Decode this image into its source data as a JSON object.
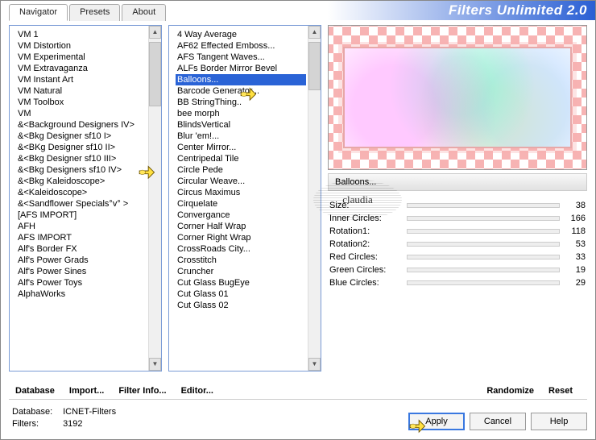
{
  "header": {
    "title": "Filters Unlimited 2.0"
  },
  "tabs": [
    {
      "label": "Navigator",
      "active": true
    },
    {
      "label": "Presets",
      "active": false
    },
    {
      "label": "About",
      "active": false
    }
  ],
  "categories": [
    "VM 1",
    "VM Distortion",
    "VM Experimental",
    "VM Extravaganza",
    "VM Instant Art",
    "VM Natural",
    "VM Toolbox",
    "VM",
    "&<Background Designers IV>",
    "&<Bkg Designer sf10 I>",
    "&<BKg Designer sf10 II>",
    "&<Bkg Designer sf10 III>",
    "&<Bkg Designers sf10 IV>",
    "&<Bkg Kaleidoscope>",
    "&<Kaleidoscope>",
    "&<Sandflower Specials°v° >",
    "[AFS IMPORT]",
    "AFH",
    "AFS IMPORT",
    "Alf's Border FX",
    "Alf's Power Grads",
    "Alf's Power Sines",
    "Alf's Power Toys",
    "AlphaWorks"
  ],
  "categories_pointer_index": 9,
  "filters": [
    "4 Way Average",
    "AF62 Effected Emboss...",
    "AFS Tangent Waves...",
    "ALFs Border Mirror Bevel",
    "Balloons...",
    "Barcode Generator...",
    "BB StringThing..",
    "bee morph",
    "BlindsVertical",
    "Blur 'em!...",
    "Center Mirror...",
    "Centripedal Tile",
    "Circle Pede",
    "Circular Weave...",
    "Circus Maximus",
    "Cirquelate",
    "Convergance",
    "Corner Half Wrap",
    "Corner Right Wrap",
    "CrossRoads City...",
    "Crosstitch",
    "Cruncher",
    "Cut Glass  BugEye",
    "Cut Glass 01",
    "Cut Glass 02"
  ],
  "filters_selected_index": 4,
  "current_filter_label": "Balloons...",
  "params": [
    {
      "label": "Size:",
      "value": 38
    },
    {
      "label": "Inner Circles:",
      "value": 166
    },
    {
      "label": "Rotation1:",
      "value": 118
    },
    {
      "label": "Rotation2:",
      "value": 53
    },
    {
      "label": "Red Circles:",
      "value": 33
    },
    {
      "label": "Green Circles:",
      "value": 19
    },
    {
      "label": "Blue Circles:",
      "value": 29
    }
  ],
  "toolbar": {
    "database": "Database",
    "import": "Import...",
    "filter_info": "Filter Info...",
    "editor": "Editor...",
    "randomize": "Randomize",
    "reset": "Reset"
  },
  "status": {
    "db_label": "Database:",
    "db_value": "ICNET-Filters",
    "filters_label": "Filters:",
    "filters_value": "3192"
  },
  "buttons": {
    "apply": "Apply",
    "cancel": "Cancel",
    "help": "Help"
  },
  "watermark": "claudia"
}
